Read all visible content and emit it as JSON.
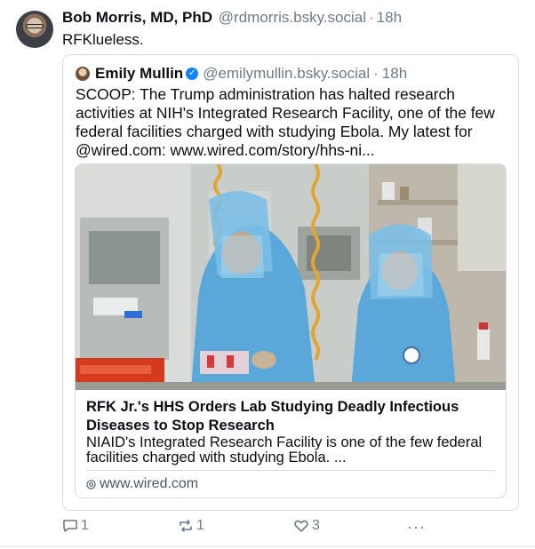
{
  "post": {
    "author_name": "Bob Morris, MD, PhD",
    "handle": "@rdmorris.bsky.social",
    "separator": "·",
    "time": "18h",
    "text": "RFKlueless."
  },
  "quote": {
    "author_name": "Emily Mullin",
    "handle": "@emilymullin.bsky.social",
    "separator": "·",
    "time": "18h",
    "text": "SCOOP: The Trump administration has halted research activities at NIH's Integrated Research Facility, one of the few federal facilities charged with studying Ebola. My latest for @wired.com: www.wired.com/story/hhs-ni..."
  },
  "link_card": {
    "title": "RFK Jr.'s HHS Orders Lab Studying Deadly Infectious Diseases to Stop Research",
    "description": "NIAID's Integrated Research Facility is one of the few federal facilities charged with studying Ebola. ...",
    "domain": "www.wired.com"
  },
  "actions": {
    "reply_count": "1",
    "repost_count": "1",
    "like_count": "3",
    "more_label": "···"
  },
  "icons": {
    "avatar": "avatar",
    "verified": "verified-check-icon",
    "globe": "globe-icon",
    "reply": "reply-icon",
    "repost": "repost-icon",
    "like": "heart-icon",
    "more": "more-icon"
  },
  "colors": {
    "text": "#0b0f14",
    "muted": "#6f7b87",
    "border": "#d4dbe2",
    "verified": "#1083fe",
    "suit_blue": "#5aa7d9"
  }
}
